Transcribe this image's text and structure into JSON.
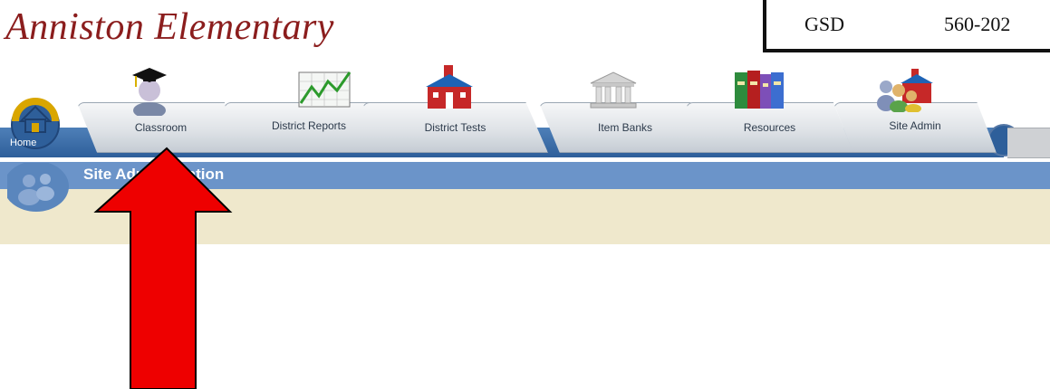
{
  "header": {
    "school_name": "Anniston Elementary",
    "code_left": "GSD",
    "code_right": "560-202"
  },
  "nav": {
    "home_label": "Home",
    "tabs": [
      {
        "label": "Classroom",
        "icon": "graduate-icon"
      },
      {
        "label": "District Reports",
        "icon": "chart-icon"
      },
      {
        "label": "District Tests",
        "icon": "schoolhouse-icon"
      },
      {
        "label": "Item Banks",
        "icon": "bank-icon"
      },
      {
        "label": "Resources",
        "icon": "books-icon"
      },
      {
        "label": "Site Admin",
        "icon": "people-school-icon"
      }
    ]
  },
  "subheader": {
    "title": "Site Administration"
  },
  "colors": {
    "title": "#8b1d1d",
    "nav_blue": "#2e5f9a",
    "sub_blue": "#6b94c9",
    "beige": "#efe8cc",
    "arrow": "#ee0000"
  }
}
